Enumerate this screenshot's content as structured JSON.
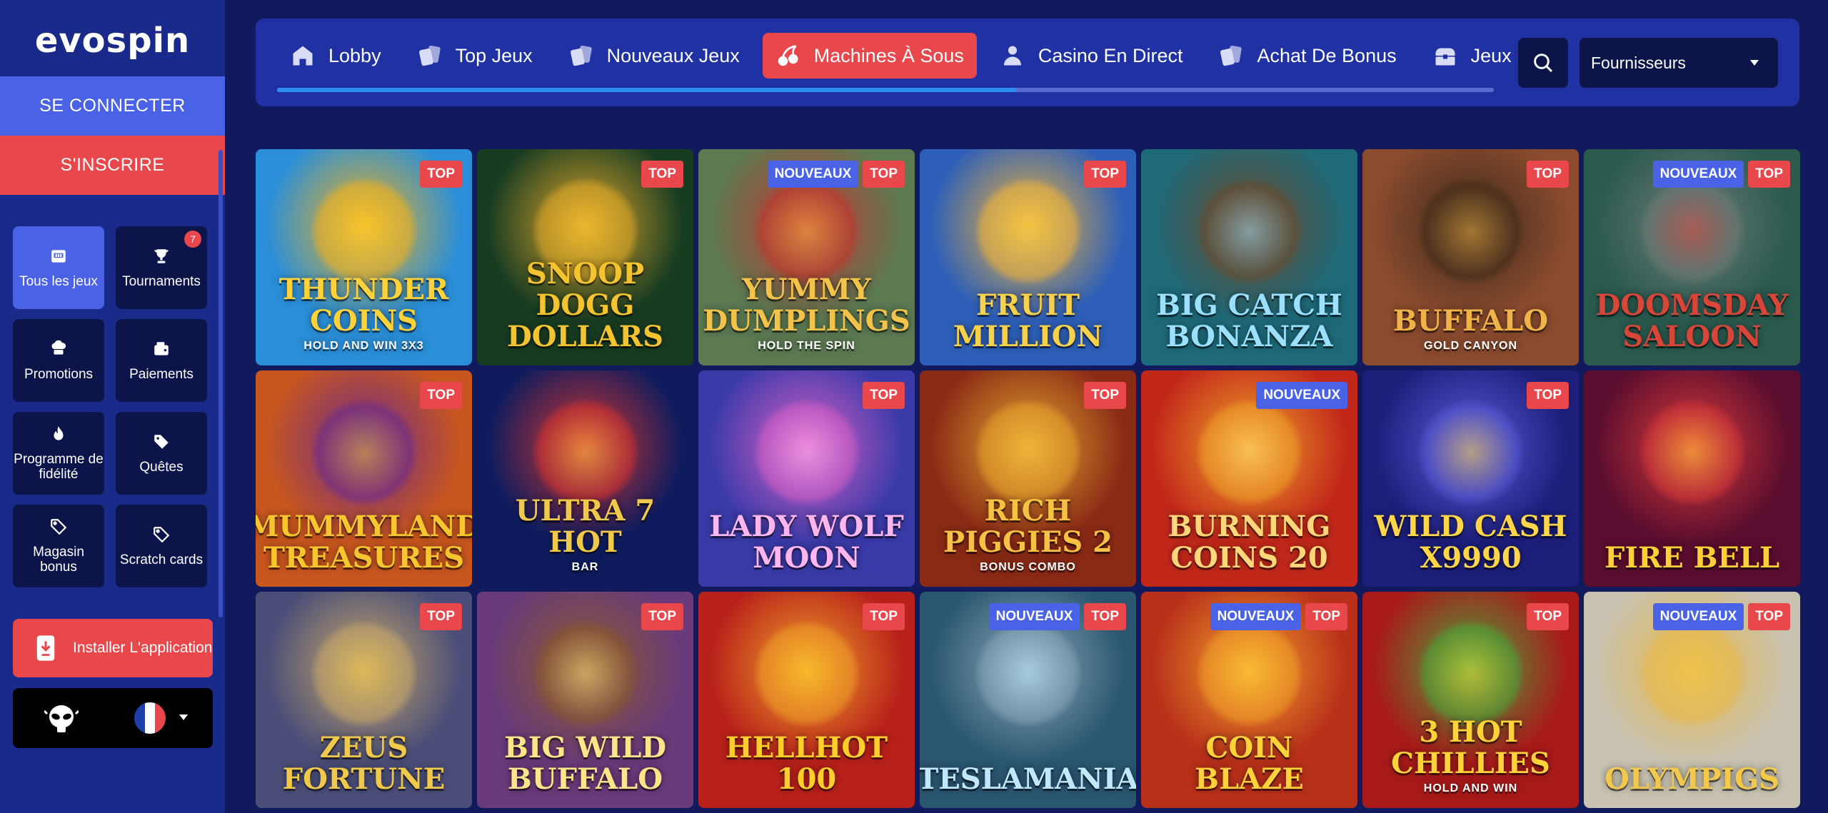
{
  "logo": "evospin",
  "auth": {
    "login": "SE CONNECTER",
    "register": "S'INSCRIRE"
  },
  "sidebar": {
    "items": [
      {
        "label": "Tous les jeux",
        "icon": "slot-machine-icon",
        "active": true
      },
      {
        "label": "Tournaments",
        "icon": "trophy-icon",
        "count": "7"
      },
      {
        "label": "Promotions",
        "icon": "chef-hat-icon"
      },
      {
        "label": "Paiements",
        "icon": "wallet-icon"
      },
      {
        "label": "Programme de fidélité",
        "icon": "flame-icon"
      },
      {
        "label": "Quêtes",
        "icon": "tag-icon"
      },
      {
        "label": "Magasin bonus",
        "icon": "tag-outline-icon"
      },
      {
        "label": "Scratch cards",
        "icon": "tag-outline-icon"
      }
    ],
    "install": "Installer L'application"
  },
  "nav": {
    "tabs": [
      {
        "label": "Lobby",
        "icon": "house-icon"
      },
      {
        "label": "Top Jeux",
        "icon": "cards-icon"
      },
      {
        "label": "Nouveaux Jeux",
        "icon": "cards-icon"
      },
      {
        "label": "Machines À Sous",
        "icon": "cherries-icon",
        "active": true
      },
      {
        "label": "Casino En Direct",
        "icon": "dealer-icon"
      },
      {
        "label": "Achat De Bonus",
        "icon": "cards-icon"
      },
      {
        "label": "Jeux",
        "icon": "chest-icon"
      }
    ],
    "providers": "Fournisseurs"
  },
  "badges": {
    "top": "TOP",
    "new": "NOUVEAUX"
  },
  "games": [
    {
      "title": "Thunder Coins",
      "sub": "HOLD AND WIN 3x3",
      "top": true,
      "new": false,
      "bg": "#2a8fd8",
      "accent": "#f3b21b",
      "color": "#ffd23a"
    },
    {
      "title": "Snoop Dogg Dollars",
      "sub": "",
      "top": true,
      "new": false,
      "bg": "#183c22",
      "accent": "#e3a92a",
      "color": "#f4c430"
    },
    {
      "title": "Yummy Dumplings",
      "sub": "HOLD THE SPIN",
      "top": true,
      "new": true,
      "bg": "#5b7a52",
      "accent": "#c4362f",
      "color": "#f2c24b"
    },
    {
      "title": "Fruit Million",
      "sub": "",
      "top": true,
      "new": false,
      "bg": "#2d5fb8",
      "accent": "#f2b53a",
      "color": "#f7d14c"
    },
    {
      "title": "Big Catch Bonanza",
      "sub": "",
      "top": false,
      "new": false,
      "bg": "#1e6a7a",
      "accent": "#6b4a2c",
      "color": "#9be0ff"
    },
    {
      "title": "Buffalo",
      "sub": "GOLD CANYON",
      "top": true,
      "new": false,
      "bg": "#8a4b2e",
      "accent": "#3f2a1a",
      "color": "#f0b347"
    },
    {
      "title": "Doomsday Saloon",
      "sub": "",
      "top": true,
      "new": true,
      "bg": "#2a5a4e",
      "accent": "#6f7a78",
      "color": "#d8463a"
    },
    {
      "title": "Mummyland Treasures",
      "sub": "",
      "top": true,
      "new": false,
      "bg": "#c8561f",
      "accent": "#6a2a8e",
      "color": "#f6c530"
    },
    {
      "title": "Ultra 7 Hot",
      "sub": "BAR",
      "top": false,
      "new": false,
      "bg": "#0e1c5e",
      "accent": "#d8352e",
      "color": "#f0c94a"
    },
    {
      "title": "Lady Wolf Moon",
      "sub": "",
      "top": true,
      "new": false,
      "bg": "#3a3aa8",
      "accent": "#d860c8",
      "color": "#ffb6ef"
    },
    {
      "title": "Rich Piggies 2",
      "sub": "BONUS COMBO",
      "top": true,
      "new": false,
      "bg": "#8a2a16",
      "accent": "#e6a52e",
      "color": "#f7c243"
    },
    {
      "title": "Burning Coins 20",
      "sub": "",
      "top": false,
      "new": true,
      "bg": "#c2281a",
      "accent": "#f0a32a",
      "color": "#ffd77a"
    },
    {
      "title": "Wild Cash x9990",
      "sub": "",
      "top": true,
      "new": false,
      "bg": "#1c1e7a",
      "accent": "#5a5ad8",
      "color": "#ffd64a"
    },
    {
      "title": "Fire Bell",
      "sub": "",
      "top": false,
      "new": false,
      "bg": "#5a0d2e",
      "accent": "#d83a3a",
      "color": "#ffcf3a"
    },
    {
      "title": "Zeus Fortune",
      "sub": "",
      "top": true,
      "new": false,
      "bg": "#4a4e78",
      "accent": "#c8a86a",
      "color": "#f0c84a"
    },
    {
      "title": "Big Wild Buffalo",
      "sub": "",
      "top": true,
      "new": false,
      "bg": "#6a3a7a",
      "accent": "#8a5a2c",
      "color": "#ffe48a"
    },
    {
      "title": "HellHot 100",
      "sub": "",
      "top": true,
      "new": false,
      "bg": "#b8201a",
      "accent": "#f0a02a",
      "color": "#ffce2a"
    },
    {
      "title": "TeslaMania",
      "sub": "",
      "top": true,
      "new": true,
      "bg": "#2a5670",
      "accent": "#8aa8b8",
      "color": "#bfe8ff"
    },
    {
      "title": "Coin Blaze",
      "sub": "",
      "top": true,
      "new": true,
      "bg": "#b8301a",
      "accent": "#f2a02a",
      "color": "#ffd23a"
    },
    {
      "title": "3 Hot Chillies",
      "sub": "HOLD AND WIN",
      "top": true,
      "new": false,
      "bg": "#a81a1a",
      "accent": "#4aa83a",
      "color": "#ffd23a"
    },
    {
      "title": "Olympigs",
      "sub": "",
      "top": true,
      "new": true,
      "bg": "#c8c2b0",
      "accent": "#e8b84a",
      "color": "#f2c94a"
    }
  ]
}
